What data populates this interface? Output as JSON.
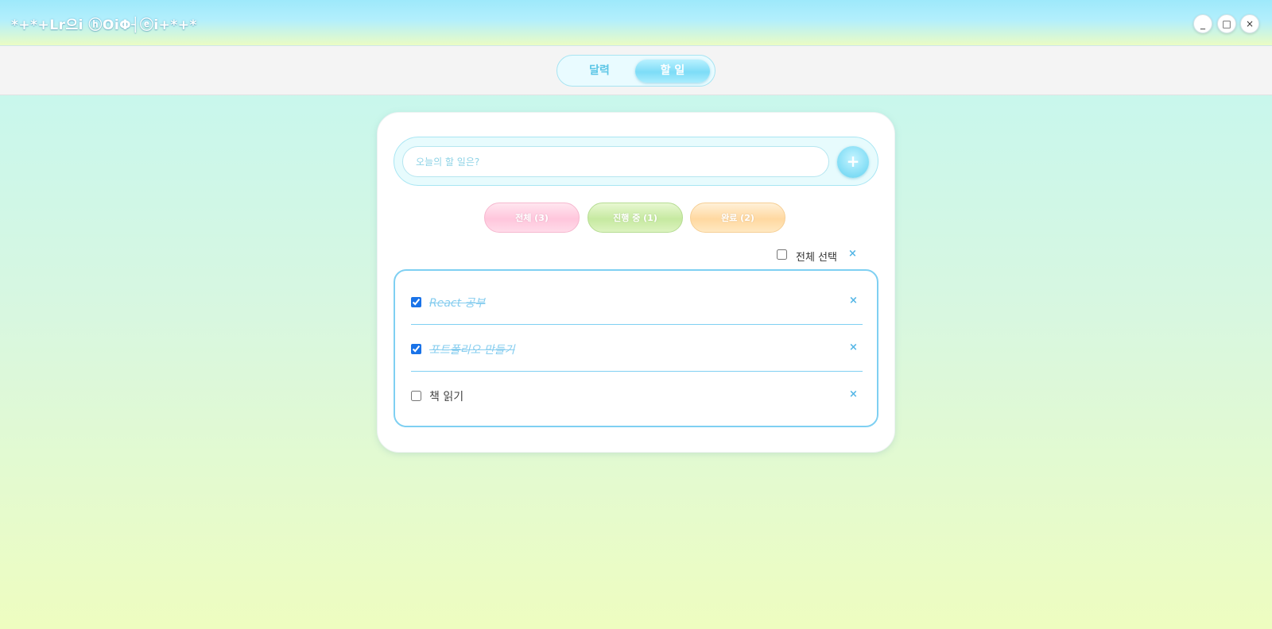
{
  "window": {
    "title": "*+*+Lr으i ⓗOiΦ┤ⓔi+*+*",
    "minimize_label": "_",
    "maximize_label": "□",
    "close_label": "×"
  },
  "nav": {
    "tabs": [
      {
        "label": "달력",
        "active": false
      },
      {
        "label": "할 일",
        "active": true
      }
    ]
  },
  "input": {
    "placeholder": "오늘의 할 일은?",
    "value": "",
    "add_label": "+"
  },
  "filters": [
    {
      "label": "전체 (3)",
      "color": "#ffc6dc"
    },
    {
      "label": "진행 중 (1)",
      "color": "#c6e9a0"
    },
    {
      "label": "완료 (2)",
      "color": "#ffd8a0"
    }
  ],
  "select_all": {
    "label": "전체 선택",
    "checked": false,
    "delete_label": "×"
  },
  "todos": [
    {
      "text": "React 공부",
      "done": true,
      "delete_label": "×"
    },
    {
      "text": "포트폴리오 만들기",
      "done": true,
      "delete_label": "×"
    },
    {
      "text": "책 읽기",
      "done": false,
      "delete_label": "×"
    }
  ],
  "colors": {
    "accent": "#7fd0f2",
    "done_text": "#86cdef"
  }
}
